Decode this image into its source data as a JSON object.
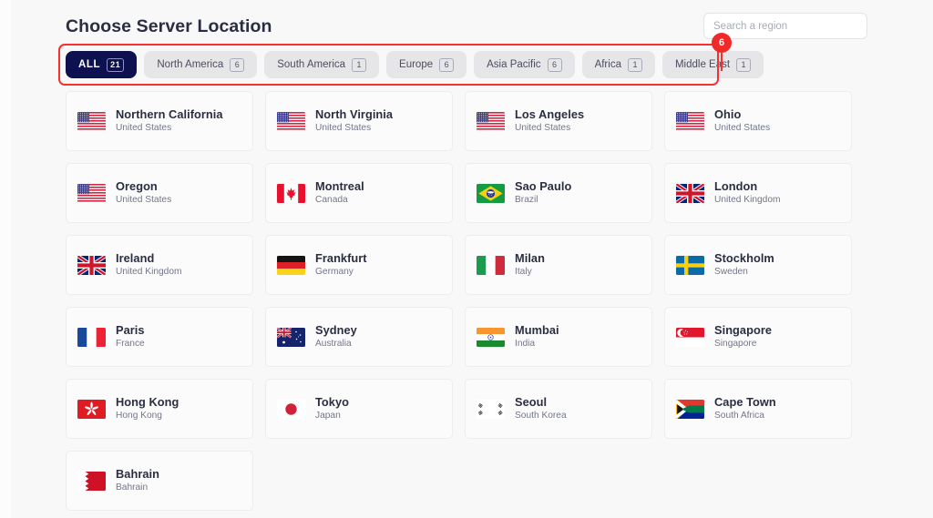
{
  "header": {
    "title": "Choose Server Location",
    "search": {
      "placeholder": "Search a region",
      "value": ""
    }
  },
  "annotation": {
    "badge_label": "6",
    "color": "#f8312f"
  },
  "filters": {
    "active_index": 0,
    "tabs": [
      {
        "label": "ALL",
        "count": "21",
        "active": true
      },
      {
        "label": "North America",
        "count": "6",
        "active": false
      },
      {
        "label": "South America",
        "count": "1",
        "active": false
      },
      {
        "label": "Europe",
        "count": "6",
        "active": false
      },
      {
        "label": "Asia Pacific",
        "count": "6",
        "active": false
      },
      {
        "label": "Africa",
        "count": "1",
        "active": false
      },
      {
        "label": "Middle East",
        "count": "1",
        "active": false
      }
    ]
  },
  "colors": {
    "active_tab_bg": "#0e1150",
    "tab_bg": "#e6e6e8",
    "page_bg": "#f8f8f9",
    "card_bg": "#fbfbfb",
    "title_text": "#2b2d42",
    "subtitle_text": "#73768a"
  },
  "locations": [
    {
      "city": "Northern California",
      "country": "United States",
      "flag": "us-flag"
    },
    {
      "city": "North Virginia",
      "country": "United States",
      "flag": "us-flag"
    },
    {
      "city": "Los Angeles",
      "country": "United States",
      "flag": "us-flag"
    },
    {
      "city": "Ohio",
      "country": "United States",
      "flag": "us-flag"
    },
    {
      "city": "Oregon",
      "country": "United States",
      "flag": "us-flag"
    },
    {
      "city": "Montreal",
      "country": "Canada",
      "flag": "ca-flag"
    },
    {
      "city": "Sao Paulo",
      "country": "Brazil",
      "flag": "br-flag"
    },
    {
      "city": "London",
      "country": "United Kingdom",
      "flag": "gb-flag"
    },
    {
      "city": "Ireland",
      "country": "United Kingdom",
      "flag": "gb-flag"
    },
    {
      "city": "Frankfurt",
      "country": "Germany",
      "flag": "de-flag"
    },
    {
      "city": "Milan",
      "country": "Italy",
      "flag": "it-flag"
    },
    {
      "city": "Stockholm",
      "country": "Sweden",
      "flag": "se-flag"
    },
    {
      "city": "Paris",
      "country": "France",
      "flag": "fr-flag"
    },
    {
      "city": "Sydney",
      "country": "Australia",
      "flag": "au-flag"
    },
    {
      "city": "Mumbai",
      "country": "India",
      "flag": "in-flag"
    },
    {
      "city": "Singapore",
      "country": "Singapore",
      "flag": "sg-flag"
    },
    {
      "city": "Hong Kong",
      "country": "Hong Kong",
      "flag": "hk-flag"
    },
    {
      "city": "Tokyo",
      "country": "Japan",
      "flag": "jp-flag"
    },
    {
      "city": "Seoul",
      "country": "South Korea",
      "flag": "kr-flag"
    },
    {
      "city": "Cape Town",
      "country": "South Africa",
      "flag": "za-flag"
    },
    {
      "city": "Bahrain",
      "country": "Bahrain",
      "flag": "bh-flag"
    }
  ]
}
